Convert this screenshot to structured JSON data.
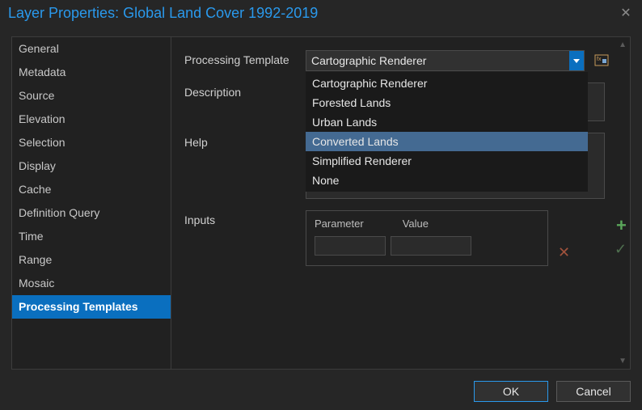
{
  "title": "Layer Properties: Global Land Cover 1992-2019",
  "sidebar": {
    "items": [
      {
        "label": "General"
      },
      {
        "label": "Metadata"
      },
      {
        "label": "Source"
      },
      {
        "label": "Elevation"
      },
      {
        "label": "Selection"
      },
      {
        "label": "Display"
      },
      {
        "label": "Cache"
      },
      {
        "label": "Definition Query"
      },
      {
        "label": "Time"
      },
      {
        "label": "Range"
      },
      {
        "label": "Mosaic"
      },
      {
        "label": "Processing Templates"
      }
    ],
    "active_index": 11
  },
  "form": {
    "template_label": "Processing Template",
    "template_value": "Cartographic Renderer",
    "description_label": "Description",
    "help_label": "Help",
    "inputs_label": "Inputs",
    "parameter_header": "Parameter",
    "value_header": "Value"
  },
  "dropdown": {
    "options": [
      "Cartographic Renderer",
      "Forested Lands",
      "Urban Lands",
      "Converted Lands",
      "Simplified Renderer",
      "None"
    ],
    "hover_index": 3
  },
  "footer": {
    "ok": "OK",
    "cancel": "Cancel"
  }
}
